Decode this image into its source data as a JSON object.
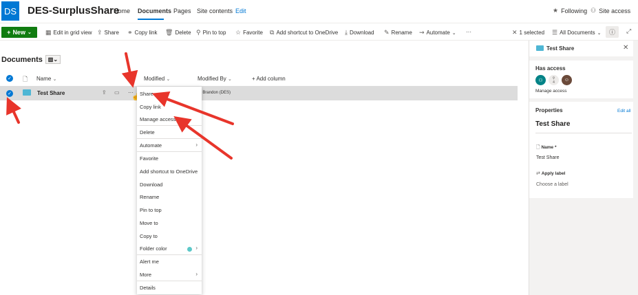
{
  "site": {
    "logo_text": "DS",
    "title": "DES-SurplusShare",
    "nav": [
      "Home",
      "Documents",
      "Pages",
      "Site contents",
      "Edit"
    ],
    "following": "Following",
    "site_access": "Site access"
  },
  "toolbar": {
    "new": "New",
    "items": [
      "Edit in grid view",
      "Share",
      "Copy link",
      "Delete",
      "Pin to top",
      "Favorite",
      "Add shortcut to OneDrive",
      "Download",
      "Rename",
      "Automate"
    ],
    "more": "···",
    "selected": "1 selected",
    "view": "All Documents"
  },
  "library": {
    "title": "Documents",
    "columns": {
      "name": "Name",
      "modified": "Modified",
      "modified_by": "Modified By",
      "add": "+ Add column"
    },
    "row": {
      "name": "Test Share",
      "modified_by": "all, Brandon (DES)",
      "more": "···"
    }
  },
  "context_menu": {
    "items": [
      "Share",
      "Copy link",
      "Manage access",
      "Delete",
      "Automate",
      "Favorite",
      "Add shortcut to OneDrive",
      "Download",
      "Rename",
      "Pin to top",
      "Move to",
      "Copy to",
      "Folder color",
      "Alert me",
      "More",
      "Details"
    ],
    "folder_color": "#5cc8c8"
  },
  "details_pane": {
    "title": "Test Share",
    "has_access": "Has access",
    "access_count": "4",
    "manage_access": "Manage access",
    "properties": "Properties",
    "edit_all": "Edit all",
    "item_title": "Test Share",
    "name_label": "Name *",
    "name_value": "Test Share",
    "apply_label": "Apply label",
    "choose_label": "Choose a label"
  },
  "colors": {
    "accent": "#0078d4",
    "new_button": "#107c10",
    "arrow": "#e8352b"
  }
}
